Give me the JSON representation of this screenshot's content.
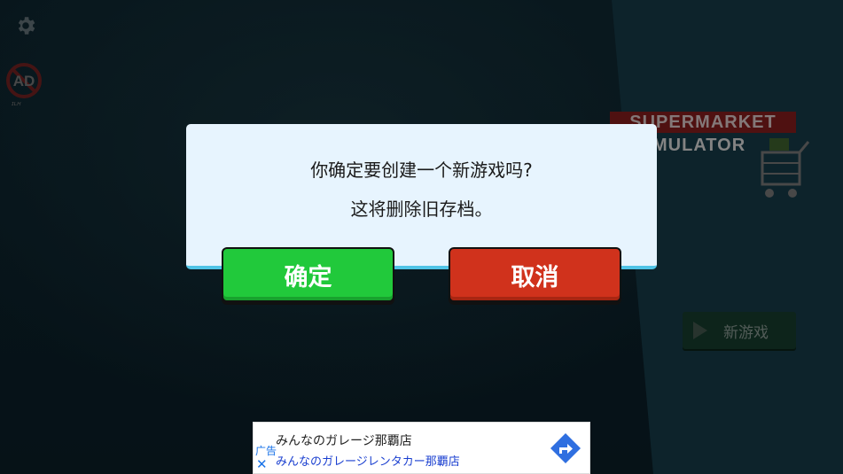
{
  "background": {
    "logo_line1": "SUPERMARKET",
    "logo_line2": "MULATOR",
    "new_game_label": "新游戏",
    "settings_icon": "gear-icon",
    "no_ads_icon": "no-ads-icon",
    "no_ads_text": "AD",
    "no_ads_caption": "ɪʟʜ"
  },
  "dialog": {
    "line1": "你确定要创建一个新游戏吗?",
    "line2": "这将删除旧存档。",
    "confirm_label": "确定",
    "cancel_label": "取消",
    "confirm_color": "#21c93b",
    "cancel_color": "#d0321c"
  },
  "ad": {
    "tag": "广告",
    "close": "✕",
    "title": "みんなのガレージ那覇店",
    "subtitle": "みんなのガレージレンタカー那覇店",
    "arrow_icon": "directions-arrow-icon"
  }
}
